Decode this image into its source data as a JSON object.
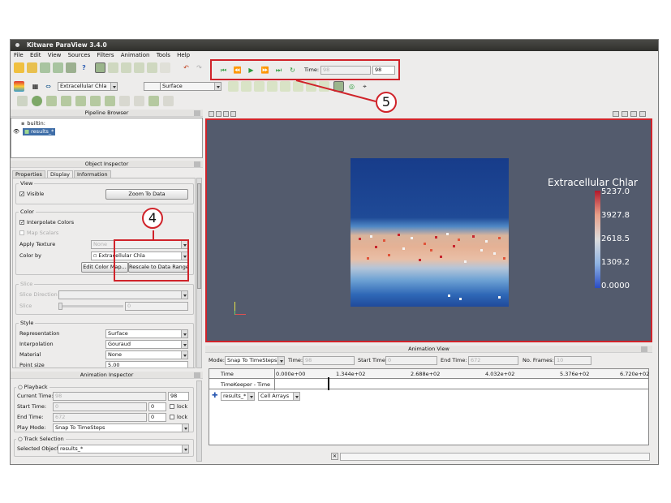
{
  "app": {
    "title": "Kitware ParaView 3.4.0"
  },
  "menu": [
    "File",
    "Edit",
    "View",
    "Sources",
    "Filters",
    "Animation",
    "Tools",
    "Help"
  ],
  "vcr": {
    "time_label": "Time:",
    "time_value": "98",
    "step_value": "98"
  },
  "toolbar2": {
    "color_array": "Extracellular Chla",
    "component": "",
    "representation": "Surface"
  },
  "pipeline": {
    "title": "Pipeline Browser",
    "items": [
      {
        "label": "builtin:"
      },
      {
        "label": "results_*"
      }
    ]
  },
  "inspector": {
    "title": "Object Inspector",
    "tabs": [
      "Properties",
      "Display",
      "Information"
    ],
    "view_group": "View",
    "visible_label": "Visible",
    "zoom_button": "Zoom To Data",
    "color_group": "Color",
    "interpolate_label": "Interpolate Colors",
    "map_scalars_label": "Map Scalars",
    "apply_texture_label": "Apply Texture",
    "apply_texture_value": "None",
    "color_by_label": "Color by",
    "color_by_value": "Extracellular Chla",
    "edit_color_button": "Edit Color Map...",
    "rescale_button": "Rescale to Data Range",
    "slice_group": "Slice",
    "slice_direction_label": "Slice Direction",
    "slice_label": "Slice",
    "slice_value": "0",
    "style_group": "Style",
    "representation_label": "Representation",
    "representation_value": "Surface",
    "interpolation_label": "Interpolation",
    "interpolation_value": "Gouraud",
    "material_label": "Material",
    "material_value": "None",
    "pointsize_label": "Point size",
    "pointsize_value": "5.00"
  },
  "anim_inspector": {
    "title": "Animation Inspector",
    "playback_group": "Playback",
    "current_time_label": "Current Time:",
    "current_time_value": "98",
    "current_time_step": "98",
    "start_time_label": "Start Time:",
    "start_time_value": "0",
    "start_time_step": "0",
    "end_time_label": "End Time:",
    "end_time_value": "672",
    "end_time_step": "0",
    "lock_label": "lock",
    "playmode_label": "Play Mode:",
    "playmode_value": "Snap To TimeSteps",
    "track_group": "Track Selection",
    "selected_object_label": "Selected Object:",
    "selected_object_value": "results_*"
  },
  "render": {
    "scalar_bar_title": "Extracellular Chlar",
    "scalar_bar_labels": [
      "5237.0",
      "3927.8",
      "2618.5",
      "1309.2",
      "0.0000"
    ],
    "bg_color": "#535b6d"
  },
  "anim_view": {
    "title": "Animation View",
    "mode_label": "Mode:",
    "mode_value": "Snap To TimeSteps",
    "time_label": "Time:",
    "time_value": "98",
    "start_label": "Start Time:",
    "start_value": "0",
    "end_label": "End Time:",
    "end_value": "672",
    "frames_label": "No. Frames:",
    "frames_value": "10",
    "header": "Time",
    "ticks": [
      "0.000e+00",
      "1.344e+02",
      "2.688e+02",
      "4.032e+02",
      "5.376e+02",
      "6.720e+02"
    ],
    "row1": "TimeKeeper - Time",
    "source_value": "results_*",
    "array_value": "Cell Arrays"
  },
  "callouts": {
    "four": "4",
    "five": "5"
  }
}
